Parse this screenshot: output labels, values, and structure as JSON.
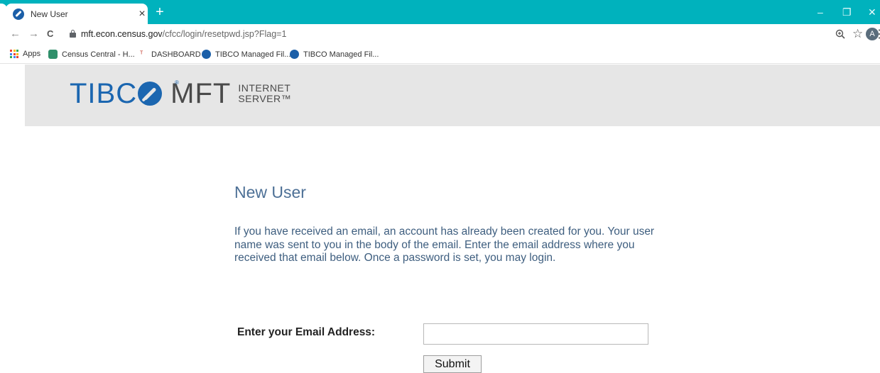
{
  "browser": {
    "tab_title": "New User",
    "tab_close": "×",
    "new_tab": "+",
    "window_controls": {
      "minimize": "–",
      "maximize": "❐",
      "close": "✕"
    },
    "nav": {
      "back": "←",
      "forward": "→",
      "reload": "C"
    },
    "url_host": "mft.econ.census.gov",
    "url_path": "/cfcc/login/resetpwd.jsp?Flag=1",
    "profile_initial": "A",
    "menu": "⋮",
    "star": "☆",
    "colors": {
      "tabbar": "#00b2bd",
      "favicon": "#1b5fa8"
    }
  },
  "bookmarks": [
    {
      "label": "Apps",
      "icon": "apps-grid-icon"
    },
    {
      "label": "Census Central - H...",
      "icon": "census-icon"
    },
    {
      "label": "DASHBOARD",
      "icon": "dashboard-icon"
    },
    {
      "label": "TIBCO Managed Fil...",
      "icon": "tibco-icon"
    },
    {
      "label": "TIBCO Managed Fil...",
      "icon": "tibco-icon"
    }
  ],
  "brand": {
    "tibco": "TIBC",
    "registered": "®",
    "product": "MFT",
    "sub_line1": "INTERNET",
    "sub_line2": "SERVER™",
    "colors": {
      "tibco_blue": "#1b66b0",
      "band": "#e6e6e6"
    }
  },
  "page": {
    "heading": "New User",
    "intro": "If you have received an email, an account has already been created for you. Your user name was sent to you in the body of the email. Enter the email address where you received that email below. Once a password is set, you may login.",
    "email_label": "Enter your Email Address:",
    "email_value": "",
    "submit_label": "Submit"
  }
}
